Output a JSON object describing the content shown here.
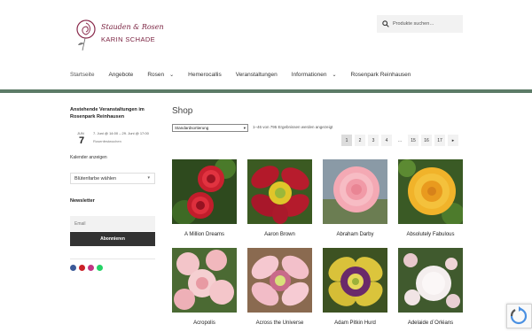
{
  "header": {
    "logo": {
      "line1": "Stauden & Rosen",
      "line2": "KARIN SCHADE",
      "icon": "rose-logo-icon"
    },
    "search": {
      "placeholder": "Produkte suchen…",
      "icon": "search-icon"
    },
    "nav": [
      {
        "label": "Startseite",
        "has_dropdown": false,
        "active": true
      },
      {
        "label": "Angebote",
        "has_dropdown": false
      },
      {
        "label": "Rosen",
        "has_dropdown": true
      },
      {
        "label": "Hemerocallis",
        "has_dropdown": false
      },
      {
        "label": "Veranstaltungen",
        "has_dropdown": false
      },
      {
        "label": "Informationen",
        "has_dropdown": true
      },
      {
        "label": "Rosenpark Reinhausen",
        "has_dropdown": false
      }
    ],
    "accent_bar_color": "#5c7b67"
  },
  "sidebar": {
    "events_title": "Anstehende Veranstaltungen im Rosenpark Reinhausen",
    "event": {
      "month": "JUN",
      "day": "7",
      "time": "7. Juni @ 14:00 – 29. Juni @ 17:00",
      "location": "Rosenfestwochen"
    },
    "calendar_link": "Kalender anzeigen",
    "color_select": "Blütenfarbe wählen",
    "newsletter_title": "Newsletter",
    "newsletter_placeholder": "Email",
    "newsletter_button": "Abonnieren",
    "social_icons": [
      "facebook-icon",
      "pinterest-icon",
      "instagram-icon",
      "whatsapp-icon"
    ]
  },
  "main": {
    "title": "Shop",
    "sort_selected": "Standardsortierung",
    "result_count": "1–46 von 795 Ergebnissen werden angezeigt",
    "pagination": [
      "1",
      "2",
      "3",
      "4",
      "…",
      "15",
      "16",
      "17",
      "▸"
    ],
    "current_page": "1",
    "products": [
      {
        "name": "A Million Dreams"
      },
      {
        "name": "Aaron Brown"
      },
      {
        "name": "Abraham Darby"
      },
      {
        "name": "Absolutely Fabulous"
      },
      {
        "name": "Acropolis"
      },
      {
        "name": "Across the Universe"
      },
      {
        "name": "Adam Pitkin Hurd"
      },
      {
        "name": "Adelaide d´Orléans"
      }
    ]
  }
}
